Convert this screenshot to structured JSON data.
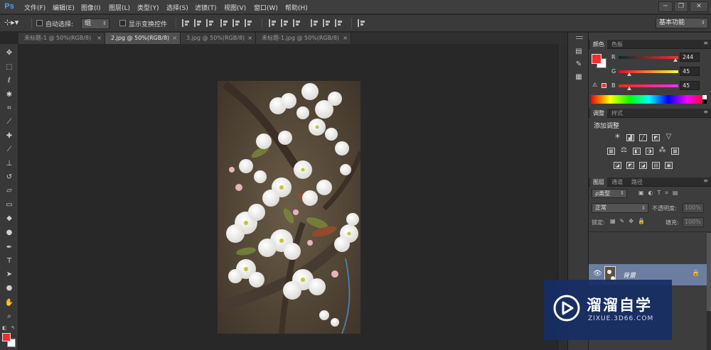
{
  "app": {
    "logo": "Ps"
  },
  "menu": [
    "文件(F)",
    "编辑(E)",
    "图像(I)",
    "图层(L)",
    "类型(Y)",
    "选择(S)",
    "滤镜(T)",
    "视图(V)",
    "窗口(W)",
    "帮助(H)"
  ],
  "window_controls": {
    "minimize": "─",
    "restore": "❐",
    "close": "✕"
  },
  "options": {
    "auto_select_label": "自动选择:",
    "auto_select_value": "组",
    "show_transform_label": "显示变换控件",
    "workspace": "基本功能"
  },
  "tabs": [
    {
      "label": "未标题-1 @ 50%(RGB/8)",
      "active": false
    },
    {
      "label": "2.jpg @ 50%(RGB/8)",
      "active": true
    },
    {
      "label": "3.jpg @ 50%(RGB/8)",
      "active": false
    },
    {
      "label": "未标题-1.jpg @ 50%(RGB/8)",
      "active": false
    }
  ],
  "tools": [
    "move-icon",
    "marquee-icon",
    "lasso-icon",
    "magic-wand-icon",
    "crop-icon",
    "eyedropper-icon",
    "healing-brush-icon",
    "brush-icon",
    "clone-stamp-icon",
    "history-brush-icon",
    "eraser-icon",
    "gradient-icon",
    "blur-icon",
    "dodge-icon",
    "pen-icon",
    "type-icon",
    "path-select-icon",
    "shape-icon",
    "hand-icon",
    "zoom-icon"
  ],
  "color_panel": {
    "tabs": [
      "颜色",
      "色板"
    ],
    "r_label": "R",
    "r_value": "244",
    "g_label": "G",
    "g_value": "45",
    "b_label": "B",
    "b_value": "45",
    "foreground": "#f42d2d"
  },
  "adjust_panel": {
    "tabs": [
      "调整",
      "样式"
    ],
    "title": "添加调整"
  },
  "layers_panel": {
    "tabs": [
      "图层",
      "通道",
      "路径"
    ],
    "filter_label": "ρ类型",
    "blend_mode": "正常",
    "opacity_label": "不透明度:",
    "opacity_value": "100%",
    "lock_label": "锁定:",
    "fill_label": "填充:",
    "fill_value": "100%",
    "layer_name": "背景"
  },
  "watermark": {
    "title": "溜溜自学",
    "url": "ZIXUE.3D66.COM"
  }
}
